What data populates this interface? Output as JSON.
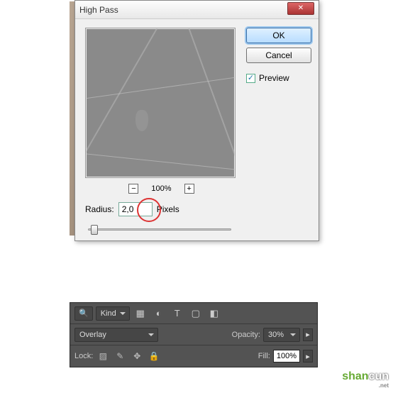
{
  "dialog": {
    "title": "High Pass",
    "ok": "OK",
    "cancel": "Cancel",
    "preview_label": "Preview",
    "preview_checked": true,
    "zoom_percent": "100%",
    "radius_label": "Radius:",
    "radius_value": "2,0",
    "radius_unit": "Pixels"
  },
  "panel": {
    "filter_label": "Kind",
    "blend_mode": "Overlay",
    "opacity_label": "Opacity:",
    "opacity_value": "30%",
    "lock_label": "Lock:",
    "fill_label": "Fill:",
    "fill_value": "100%"
  },
  "watermark": {
    "text1": "shan",
    "text2": "cun",
    "sub": ".net"
  }
}
